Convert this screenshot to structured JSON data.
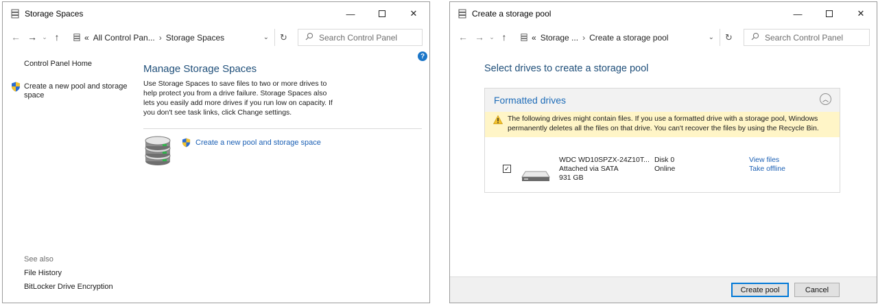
{
  "w1": {
    "title": "Storage Spaces",
    "address": {
      "overflow": "«",
      "crumb1": "All Control Pan...",
      "sep": "›",
      "crumb2": "Storage Spaces"
    },
    "search_placeholder": "Search Control Panel",
    "left": {
      "home": "Control Panel Home",
      "create_link_line1": "Create a new pool and storage",
      "create_link_line2": "space",
      "see_also": "See also",
      "file_history": "File History",
      "bitlocker": "BitLocker Drive Encryption"
    },
    "main": {
      "heading": "Manage Storage Spaces",
      "desc_lines": [
        "Use Storage Spaces to save files to two or more drives to",
        "help protect you from a drive failure. Storage Spaces also",
        "lets you easily add more drives if you run low on capacity. If",
        "you don't see task links, click Change settings."
      ],
      "create_link": "Create a new pool and storage space"
    }
  },
  "w2": {
    "title": "Create a storage pool",
    "address": {
      "overflow": "«",
      "crumb1": "Storage ...",
      "sep": "›",
      "crumb2": "Create a storage pool"
    },
    "search_placeholder": "Search Control Panel",
    "heading": "Select drives to create a storage pool",
    "group_title": "Formatted drives",
    "warning_lines": [
      "The following drives might contain files. If you use a formatted drive with a storage pool, Windows",
      "permanently deletes all the files on that drive. You can't recover the files by using the Recycle Bin."
    ],
    "drive": {
      "name": "WDC WD10SPZX-24Z10T...",
      "connection": "Attached via SATA",
      "size": "931 GB",
      "disk": "Disk 0",
      "status": "Online",
      "view_files": "View files",
      "take_offline": "Take offline",
      "checked": true
    },
    "buttons": {
      "create_pool": "Create pool",
      "cancel": "Cancel"
    }
  },
  "colors": {
    "link": "#1a5fb4",
    "heading": "#1e4e79",
    "accent": "#0078d7",
    "warning_bg": "#fff5c7"
  },
  "icons": [
    "storage-spaces-icon",
    "minimize-icon",
    "maximize-icon",
    "close-icon",
    "back-arrow-icon",
    "forward-arrow-icon",
    "recent-dropdown-icon",
    "up-arrow-icon",
    "refresh-icon",
    "search-icon",
    "uac-shield-icon",
    "help-icon",
    "drive-stack-icon",
    "warning-icon",
    "collapse-icon",
    "hard-drive-icon"
  ]
}
